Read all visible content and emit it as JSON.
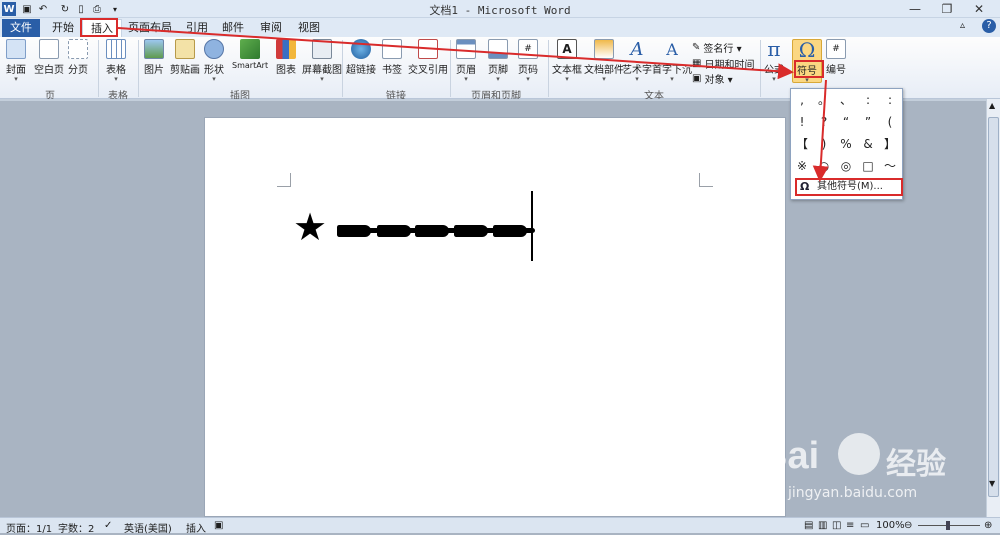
{
  "window": {
    "title": "文档1 - Microsoft Word",
    "controls": [
      "—",
      "❐",
      "✕"
    ],
    "help": "?"
  },
  "tabs": [
    "文件",
    "开始",
    "插入",
    "页面布局",
    "引用",
    "邮件",
    "审阅",
    "视图"
  ],
  "ribbon": {
    "groups": {
      "pages": {
        "label": "页",
        "buttons": [
          "封面",
          "空白页",
          "分页"
        ]
      },
      "tables": {
        "label": "表格",
        "buttons": [
          "表格"
        ]
      },
      "illustrations": {
        "label": "插图",
        "buttons": [
          "图片",
          "剪贴画",
          "形状",
          "SmartArt",
          "图表",
          "屏幕截图"
        ]
      },
      "links": {
        "label": "链接",
        "buttons": [
          "超链接",
          "书签",
          "交叉引用"
        ]
      },
      "header_footer": {
        "label": "页眉和页脚",
        "buttons": [
          "页眉",
          "页脚",
          "页码"
        ]
      },
      "text": {
        "label": "文本",
        "buttons": [
          "文本框",
          "文档部件",
          "艺术字",
          "首字下沉"
        ],
        "small": [
          "签名行 ▾",
          "日期和时间",
          "对象 ▾"
        ]
      },
      "symbols": {
        "buttons": [
          "公式",
          "符号",
          "编号"
        ]
      }
    }
  },
  "symbol_panel": {
    "rows": [
      [
        ",",
        "。",
        "、",
        ":",
        ":"
      ],
      [
        "!",
        "?",
        "“",
        "”",
        "("
      ],
      [
        "【",
        ")",
        "%",
        "&",
        "】"
      ],
      [
        "※",
        "○",
        "◎",
        "□",
        "～"
      ]
    ],
    "more": "其他符号(M)..."
  },
  "document": {
    "star": "★",
    "hand_count": 5
  },
  "status": {
    "page": "页面：1/1",
    "words": "字数：2",
    "language": "英语(美国)",
    "mode": "插入",
    "zoom": "100%"
  },
  "watermark": {
    "brand": "Bai",
    "brand2": "经验",
    "url": "jingyan.baidu.com"
  },
  "colors": {
    "accent": "#2a5ea7",
    "highlight": "#d92b2b"
  }
}
